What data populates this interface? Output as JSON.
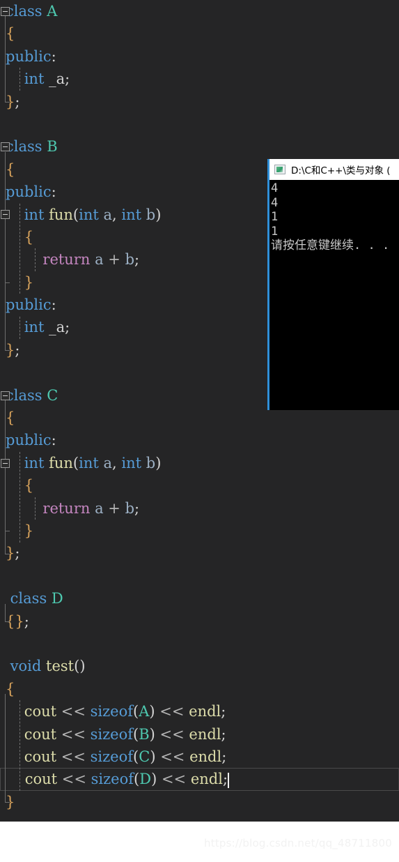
{
  "editor": {
    "background_color": "#252526",
    "font_size_px": 21,
    "line_height_px": 32.4,
    "colors": {
      "keyword": "#569cd6",
      "type_name": "#4ec9b0",
      "function": "#dcdcaa",
      "control_keyword": "#c586c0",
      "identifier": "#d4d4d4",
      "parameter": "#9cb0c4",
      "brace": "#d8a35c"
    },
    "current_line_number": 32,
    "lines": [
      {
        "n": 1,
        "indent": 0,
        "fold": "open",
        "tokens": [
          {
            "t": "class ",
            "c": "kw"
          },
          {
            "t": "A",
            "c": "type"
          }
        ]
      },
      {
        "n": 2,
        "indent": 0,
        "tokens": [
          {
            "t": "{",
            "c": "brace"
          }
        ]
      },
      {
        "n": 3,
        "indent": 0,
        "tokens": [
          {
            "t": "public",
            "c": "kw"
          },
          {
            "t": ":",
            "c": "punct"
          }
        ]
      },
      {
        "n": 4,
        "indent": 1,
        "tokens": [
          {
            "t": "int",
            "c": "kw"
          },
          {
            "t": " ",
            "c": "plain"
          },
          {
            "t": "_a",
            "c": "plain"
          },
          {
            "t": ";",
            "c": "punct"
          }
        ]
      },
      {
        "n": 5,
        "indent": 0,
        "tokens": [
          {
            "t": "}",
            "c": "brace"
          },
          {
            "t": ";",
            "c": "punct"
          }
        ]
      },
      {
        "n": 6,
        "indent": 0,
        "tokens": []
      },
      {
        "n": 7,
        "indent": 0,
        "fold": "open",
        "tokens": [
          {
            "t": "class ",
            "c": "kw"
          },
          {
            "t": "B",
            "c": "type"
          }
        ]
      },
      {
        "n": 8,
        "indent": 0,
        "tokens": [
          {
            "t": "{",
            "c": "brace"
          }
        ]
      },
      {
        "n": 9,
        "indent": 0,
        "tokens": [
          {
            "t": "public",
            "c": "kw"
          },
          {
            "t": ":",
            "c": "punct"
          }
        ]
      },
      {
        "n": 10,
        "indent": 1,
        "fold": "open",
        "tokens": [
          {
            "t": "int",
            "c": "kw"
          },
          {
            "t": " ",
            "c": "plain"
          },
          {
            "t": "fun",
            "c": "fn"
          },
          {
            "t": "(",
            "c": "punct"
          },
          {
            "t": "int",
            "c": "kw"
          },
          {
            "t": " ",
            "c": "plain"
          },
          {
            "t": "a",
            "c": "param"
          },
          {
            "t": ", ",
            "c": "punct"
          },
          {
            "t": "int",
            "c": "kw"
          },
          {
            "t": " ",
            "c": "plain"
          },
          {
            "t": "b",
            "c": "param"
          },
          {
            "t": ")",
            "c": "punct"
          }
        ]
      },
      {
        "n": 11,
        "indent": 1,
        "tokens": [
          {
            "t": "{",
            "c": "brace"
          }
        ]
      },
      {
        "n": 12,
        "indent": 2,
        "tokens": [
          {
            "t": "return",
            "c": "ctrl"
          },
          {
            "t": " ",
            "c": "plain"
          },
          {
            "t": "a",
            "c": "param"
          },
          {
            "t": " + ",
            "c": "op"
          },
          {
            "t": "b",
            "c": "param"
          },
          {
            "t": ";",
            "c": "punct"
          }
        ]
      },
      {
        "n": 13,
        "indent": 1,
        "tokens": [
          {
            "t": "}",
            "c": "brace"
          }
        ]
      },
      {
        "n": 14,
        "indent": 0,
        "tokens": [
          {
            "t": "public",
            "c": "kw"
          },
          {
            "t": ":",
            "c": "punct"
          }
        ]
      },
      {
        "n": 15,
        "indent": 1,
        "tokens": [
          {
            "t": "int",
            "c": "kw"
          },
          {
            "t": " ",
            "c": "plain"
          },
          {
            "t": "_a",
            "c": "plain"
          },
          {
            "t": ";",
            "c": "punct"
          }
        ]
      },
      {
        "n": 16,
        "indent": 0,
        "tokens": [
          {
            "t": "}",
            "c": "brace"
          },
          {
            "t": ";",
            "c": "punct"
          }
        ]
      },
      {
        "n": 17,
        "indent": 0,
        "tokens": []
      },
      {
        "n": 18,
        "indent": 0,
        "fold": "open",
        "tokens": [
          {
            "t": "class ",
            "c": "kw"
          },
          {
            "t": "C",
            "c": "type"
          }
        ]
      },
      {
        "n": 19,
        "indent": 0,
        "tokens": [
          {
            "t": "{",
            "c": "brace"
          }
        ]
      },
      {
        "n": 20,
        "indent": 0,
        "tokens": [
          {
            "t": "public",
            "c": "kw"
          },
          {
            "t": ":",
            "c": "punct"
          }
        ]
      },
      {
        "n": 21,
        "indent": 1,
        "fold": "open",
        "tokens": [
          {
            "t": "int",
            "c": "kw"
          },
          {
            "t": " ",
            "c": "plain"
          },
          {
            "t": "fun",
            "c": "fn"
          },
          {
            "t": "(",
            "c": "punct"
          },
          {
            "t": "int",
            "c": "kw"
          },
          {
            "t": " ",
            "c": "plain"
          },
          {
            "t": "a",
            "c": "param"
          },
          {
            "t": ", ",
            "c": "punct"
          },
          {
            "t": "int",
            "c": "kw"
          },
          {
            "t": " ",
            "c": "plain"
          },
          {
            "t": "b",
            "c": "param"
          },
          {
            "t": ")",
            "c": "punct"
          }
        ]
      },
      {
        "n": 22,
        "indent": 1,
        "tokens": [
          {
            "t": "{",
            "c": "brace"
          }
        ]
      },
      {
        "n": 23,
        "indent": 2,
        "tokens": [
          {
            "t": "return",
            "c": "ctrl"
          },
          {
            "t": " ",
            "c": "plain"
          },
          {
            "t": "a",
            "c": "param"
          },
          {
            "t": " + ",
            "c": "op"
          },
          {
            "t": "b",
            "c": "param"
          },
          {
            "t": ";",
            "c": "punct"
          }
        ]
      },
      {
        "n": 24,
        "indent": 1,
        "tokens": [
          {
            "t": "}",
            "c": "brace"
          }
        ]
      },
      {
        "n": 25,
        "indent": 0,
        "tokens": [
          {
            "t": "}",
            "c": "brace"
          },
          {
            "t": ";",
            "c": "punct"
          }
        ]
      },
      {
        "n": 26,
        "indent": 0,
        "tokens": []
      },
      {
        "n": 27,
        "indent": 0,
        "tokens": [
          {
            "t": " class ",
            "c": "kw"
          },
          {
            "t": "D",
            "c": "type"
          }
        ]
      },
      {
        "n": 28,
        "indent": 0,
        "tokens": [
          {
            "t": "{}",
            "c": "brace"
          },
          {
            "t": ";",
            "c": "punct"
          }
        ]
      },
      {
        "n": 29,
        "indent": 0,
        "tokens": []
      },
      {
        "n": 30,
        "indent": 0,
        "tokens": [
          {
            "t": " void",
            "c": "kw"
          },
          {
            "t": " ",
            "c": "plain"
          },
          {
            "t": "test",
            "c": "fn"
          },
          {
            "t": "()",
            "c": "punct"
          }
        ]
      },
      {
        "n": 31,
        "indent": 0,
        "tokens": [
          {
            "t": "{",
            "c": "brace"
          }
        ]
      },
      {
        "n": 32,
        "indent": 1,
        "tokens": [
          {
            "t": "cout",
            "c": "fn"
          },
          {
            "t": " << ",
            "c": "op"
          },
          {
            "t": "sizeof",
            "c": "kw"
          },
          {
            "t": "(",
            "c": "punct"
          },
          {
            "t": "A",
            "c": "type"
          },
          {
            "t": ")",
            "c": "punct"
          },
          {
            "t": " << ",
            "c": "op"
          },
          {
            "t": "endl",
            "c": "fn"
          },
          {
            "t": ";",
            "c": "punct"
          }
        ]
      },
      {
        "n": 33,
        "indent": 1,
        "tokens": [
          {
            "t": "cout",
            "c": "fn"
          },
          {
            "t": " << ",
            "c": "op"
          },
          {
            "t": "sizeof",
            "c": "kw"
          },
          {
            "t": "(",
            "c": "punct"
          },
          {
            "t": "B",
            "c": "type"
          },
          {
            "t": ")",
            "c": "punct"
          },
          {
            "t": " << ",
            "c": "op"
          },
          {
            "t": "endl",
            "c": "fn"
          },
          {
            "t": ";",
            "c": "punct"
          }
        ]
      },
      {
        "n": 34,
        "indent": 1,
        "tokens": [
          {
            "t": "cout",
            "c": "fn"
          },
          {
            "t": " << ",
            "c": "op"
          },
          {
            "t": "sizeof",
            "c": "kw"
          },
          {
            "t": "(",
            "c": "punct"
          },
          {
            "t": "C",
            "c": "type"
          },
          {
            "t": ")",
            "c": "punct"
          },
          {
            "t": " << ",
            "c": "op"
          },
          {
            "t": "endl",
            "c": "fn"
          },
          {
            "t": ";",
            "c": "punct"
          }
        ]
      },
      {
        "n": 35,
        "indent": 1,
        "current": true,
        "caret": true,
        "tokens": [
          {
            "t": "cout",
            "c": "fn"
          },
          {
            "t": " << ",
            "c": "op"
          },
          {
            "t": "sizeof",
            "c": "kw"
          },
          {
            "t": "(",
            "c": "punct"
          },
          {
            "t": "D",
            "c": "type"
          },
          {
            "t": ")",
            "c": "punct"
          },
          {
            "t": " << ",
            "c": "op"
          },
          {
            "t": "endl",
            "c": "fn"
          },
          {
            "t": ";",
            "c": "punct"
          }
        ]
      },
      {
        "n": 36,
        "indent": 0,
        "tokens": [
          {
            "t": "}",
            "c": "brace"
          }
        ]
      }
    ]
  },
  "console": {
    "title": "D:\\C和C++\\类与对象 (",
    "icon": "console-app-icon",
    "background_color": "#000000",
    "titlebar_color": "#ffffff",
    "border_accent_color": "#2f8fd8",
    "output_lines": [
      "4",
      "4",
      "1",
      "1",
      "请按任意键继续. . ."
    ]
  },
  "watermark": {
    "text": "https://blog.csdn.net/qq_48711800"
  }
}
